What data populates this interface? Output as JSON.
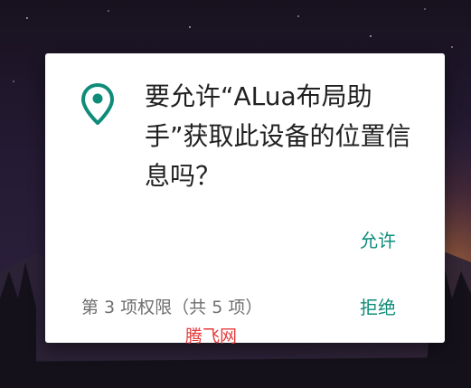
{
  "dialog": {
    "message": "要允许“ALua布局助手”获取此设备的位置信息吗？",
    "allow_label": "允许",
    "deny_label": "拒绝",
    "counter_text": "第 3 项权限（共 5 项）",
    "icon": "location-pin-icon",
    "accent_color": "#0f8c79"
  },
  "watermark": {
    "text": "腾飞网"
  }
}
